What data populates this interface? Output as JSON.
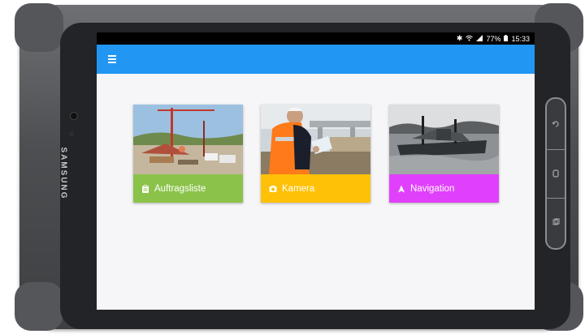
{
  "device": {
    "brand": "SAMSUNG"
  },
  "statusbar": {
    "icons": [
      "bluetooth-icon",
      "wifi-icon",
      "signal-icon",
      "battery-icon"
    ],
    "battery": "77%",
    "time": "15:33"
  },
  "appbar": {
    "menu_icon": "hamburger-menu-icon",
    "color": "#2196f3"
  },
  "tiles": [
    {
      "label": "Auftragsliste",
      "icon": "clipboard-icon",
      "color": "#8bc34a"
    },
    {
      "label": "Kamera",
      "icon": "camera-icon",
      "color": "#ffc107"
    },
    {
      "label": "Navigation",
      "icon": "navigation-arrow-icon",
      "color": "#e040fb"
    }
  ]
}
